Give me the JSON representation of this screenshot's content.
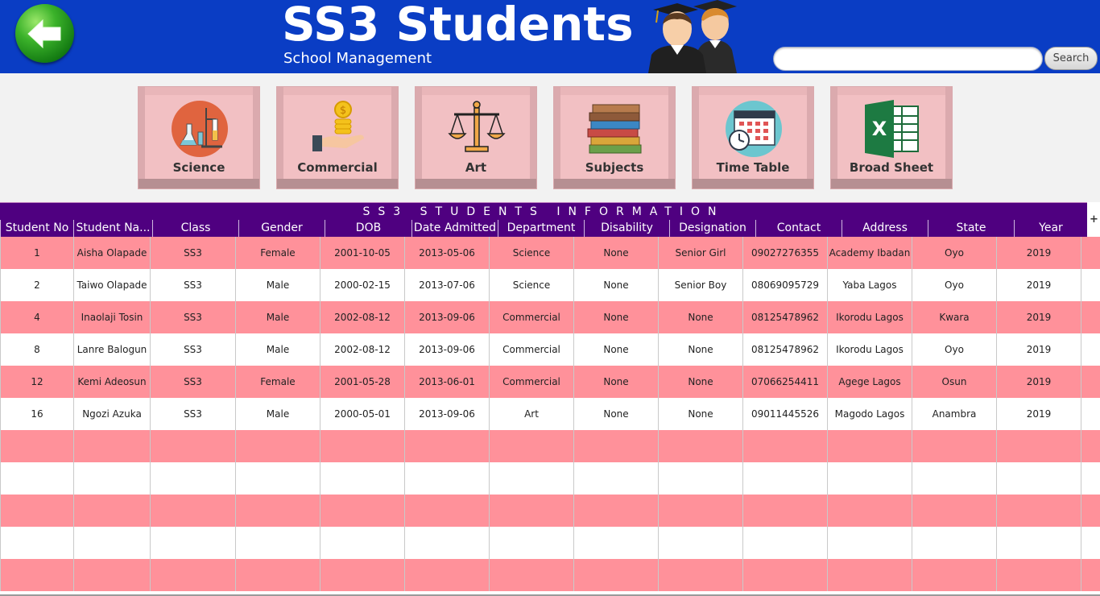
{
  "header": {
    "title": "SS3 Students",
    "subtitle": "School Management",
    "search_placeholder": "",
    "search_label": "Search",
    "bg_color": "#0a3dc4"
  },
  "tiles": [
    {
      "label": "Science",
      "icon": "science-lab-icon"
    },
    {
      "label": "Commercial",
      "icon": "money-hand-icon"
    },
    {
      "label": "Art",
      "icon": "scales-icon"
    },
    {
      "label": "Subjects",
      "icon": "books-icon"
    },
    {
      "label": "Time Table",
      "icon": "calendar-clock-icon"
    },
    {
      "label": "Broad Sheet",
      "icon": "excel-icon"
    }
  ],
  "table": {
    "title": "SS3 STUDENTS INFORMATION",
    "columns": [
      "Student No",
      "Student Na...",
      "Class",
      "Gender",
      "DOB",
      "Date Admitted",
      "Department",
      "Disability",
      "Designation",
      "Contact",
      "Address",
      "State",
      "Year"
    ],
    "rows": [
      [
        "1",
        "Aisha Olapade",
        "SS3",
        "Female",
        "2001-10-05",
        "2013-05-06",
        "Science",
        "None",
        "Senior Girl",
        "09027276355",
        "Academy Ibadan",
        "Oyo",
        "2019"
      ],
      [
        "2",
        "Taiwo Olapade",
        "SS3",
        "Male",
        "2000-02-15",
        "2013-07-06",
        "Science",
        "None",
        "Senior Boy",
        "08069095729",
        "Yaba Lagos",
        "Oyo",
        "2019"
      ],
      [
        "4",
        "Inaolaji Tosin",
        "SS3",
        "Male",
        "2002-08-12",
        "2013-09-06",
        "Commercial",
        "None",
        "None",
        "08125478962",
        "Ikorodu Lagos",
        "Kwara",
        "2019"
      ],
      [
        "8",
        "Lanre Balogun",
        "SS3",
        "Male",
        "2002-08-12",
        "2013-09-06",
        "Commercial",
        "None",
        "None",
        "08125478962",
        "Ikorodu Lagos",
        "Oyo",
        "2019"
      ],
      [
        "12",
        "Kemi Adeosun",
        "SS3",
        "Female",
        "2001-05-28",
        "2013-06-01",
        "Commercial",
        "None",
        "None",
        "07066254411",
        "Agege Lagos",
        "Osun",
        "2019"
      ],
      [
        "16",
        "Ngozi Azuka",
        "SS3",
        "Male",
        "2000-05-01",
        "2013-09-06",
        "Art",
        "None",
        "None",
        "09011445526",
        "Magodo Lagos",
        "Anambra",
        "2019"
      ]
    ],
    "empty_rows": 5,
    "header_color": "#4f0080",
    "row_pink": "#ff919a",
    "row_white": "#ffffff"
  }
}
